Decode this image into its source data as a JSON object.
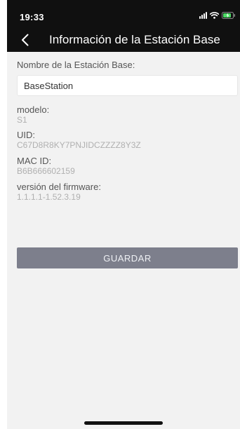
{
  "status_bar": {
    "time": "19:33"
  },
  "header": {
    "title": "Información de la Estación Base",
    "back_icon": "chevron-left-icon"
  },
  "form": {
    "name_label": "Nombre de la Estación Base:",
    "name_value": "BaseStation",
    "model_label": "modelo:",
    "model_value": "S1",
    "uid_label": "UID:",
    "uid_value": "C67D8R8KY7PNJIDCZZZZ8Y3Z",
    "mac_label": "MAC ID:",
    "mac_value": "B6B666602159",
    "firmware_label": "versión del firmware:",
    "firmware_value": "1.1.1.1-1.52.3.19"
  },
  "actions": {
    "save_label": "GUARDAR"
  },
  "colors": {
    "header_bg": "#101010",
    "page_bg": "#f2f2f2",
    "button_bg": "#7d7f8c",
    "battery_green": "#4cd964"
  }
}
